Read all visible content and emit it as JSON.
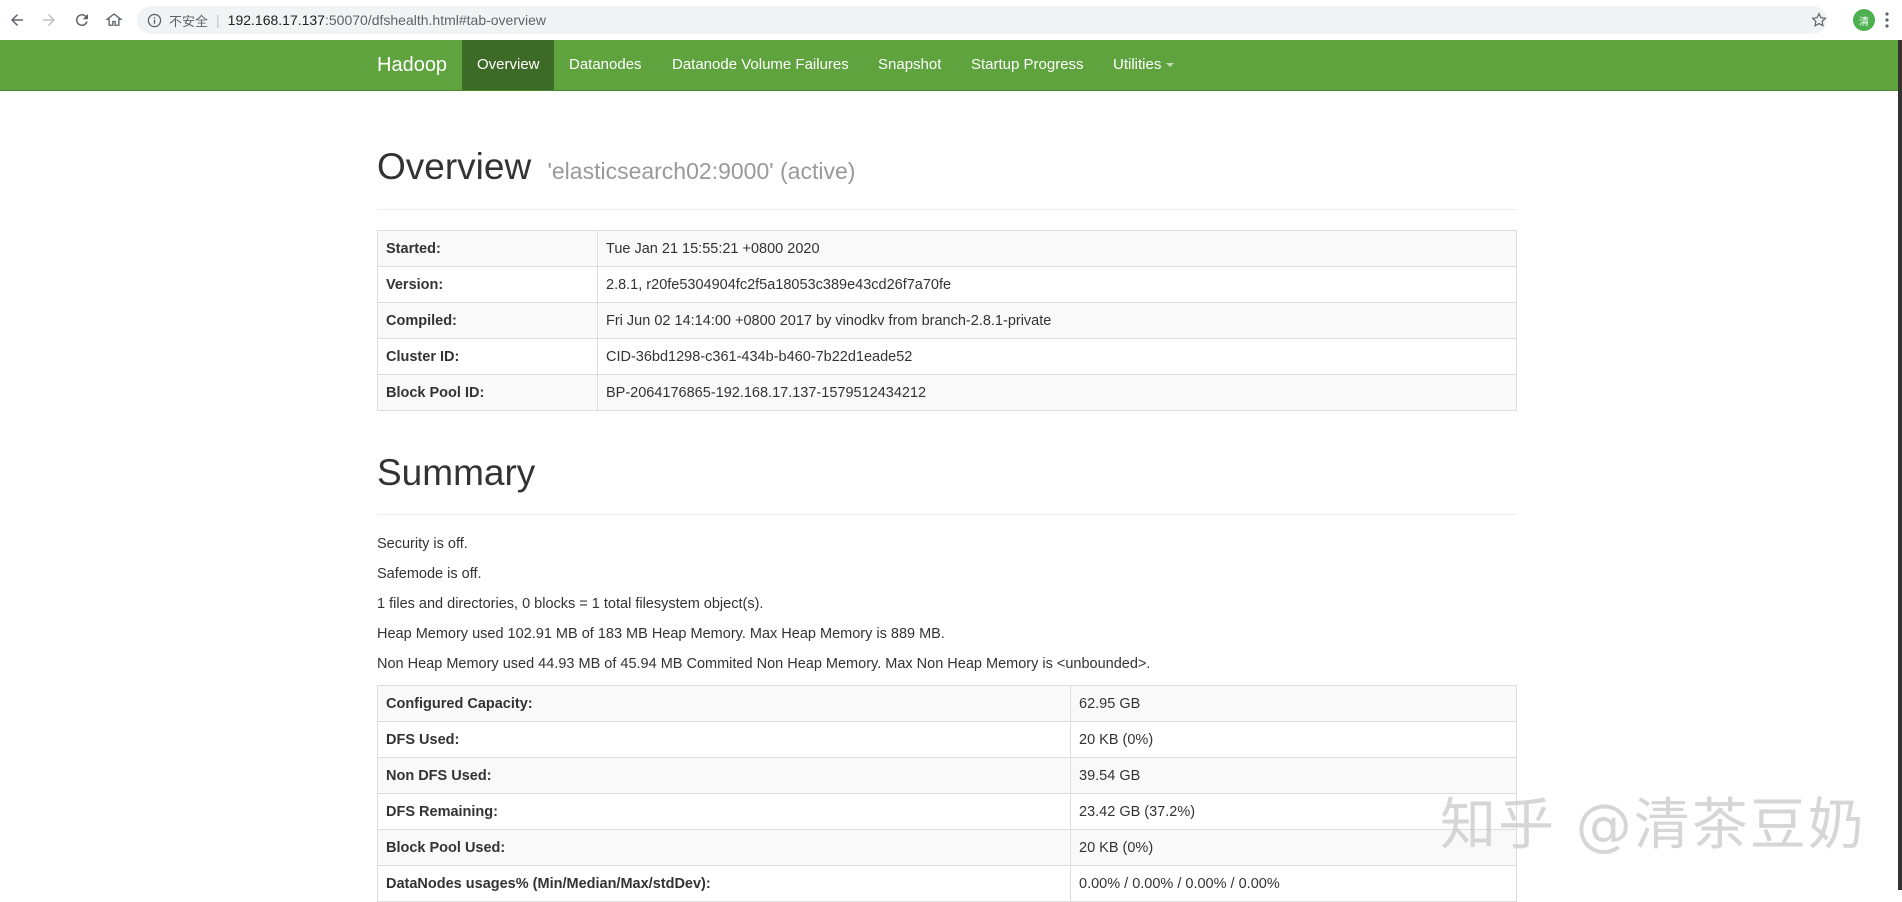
{
  "browser": {
    "security_label": "不安全",
    "url_host": "192.168.17.137",
    "url_path": ":50070/dfshealth.html#tab-overview",
    "avatar_text": "清"
  },
  "navbar": {
    "brand": "Hadoop",
    "items": [
      {
        "label": "Overview",
        "active": true
      },
      {
        "label": "Datanodes"
      },
      {
        "label": "Datanode Volume Failures"
      },
      {
        "label": "Snapshot"
      },
      {
        "label": "Startup Progress"
      },
      {
        "label": "Utilities"
      }
    ]
  },
  "overview": {
    "title": "Overview",
    "subtitle": "'elasticsearch02:9000' (active)",
    "rows": [
      {
        "key": "Started:",
        "value": "Tue Jan 21 15:55:21 +0800 2020"
      },
      {
        "key": "Version:",
        "value": "2.8.1, r20fe5304904fc2f5a18053c389e43cd26f7a70fe"
      },
      {
        "key": "Compiled:",
        "value": "Fri Jun 02 14:14:00 +0800 2017 by vinodkv from branch-2.8.1-private"
      },
      {
        "key": "Cluster ID:",
        "value": "CID-36bd1298-c361-434b-b460-7b22d1eade52"
      },
      {
        "key": "Block Pool ID:",
        "value": "BP-2064176865-192.168.17.137-1579512434212"
      }
    ]
  },
  "summary": {
    "title": "Summary",
    "lines": [
      "Security is off.",
      "Safemode is off.",
      "1 files and directories, 0 blocks = 1 total filesystem object(s).",
      "Heap Memory used 102.91 MB of 183 MB Heap Memory. Max Heap Memory is 889 MB.",
      "Non Heap Memory used 44.93 MB of 45.94 MB Commited Non Heap Memory. Max Non Heap Memory is <unbounded>."
    ],
    "rows": [
      {
        "key": "Configured Capacity:",
        "value": "62.95 GB"
      },
      {
        "key": "DFS Used:",
        "value": "20 KB (0%)"
      },
      {
        "key": "Non DFS Used:",
        "value": "39.54 GB"
      },
      {
        "key": "DFS Remaining:",
        "value": "23.42 GB (37.2%)"
      },
      {
        "key": "Block Pool Used:",
        "value": "20 KB (0%)"
      },
      {
        "key": "DataNodes usages% (Min/Median/Max/stdDev):",
        "value": "0.00% / 0.00% / 0.00% / 0.00%"
      }
    ]
  },
  "watermark": "知乎 @清茶豆奶",
  "colors": {
    "navbar": "#5fa33e",
    "navbar_active": "#3d6b27"
  }
}
